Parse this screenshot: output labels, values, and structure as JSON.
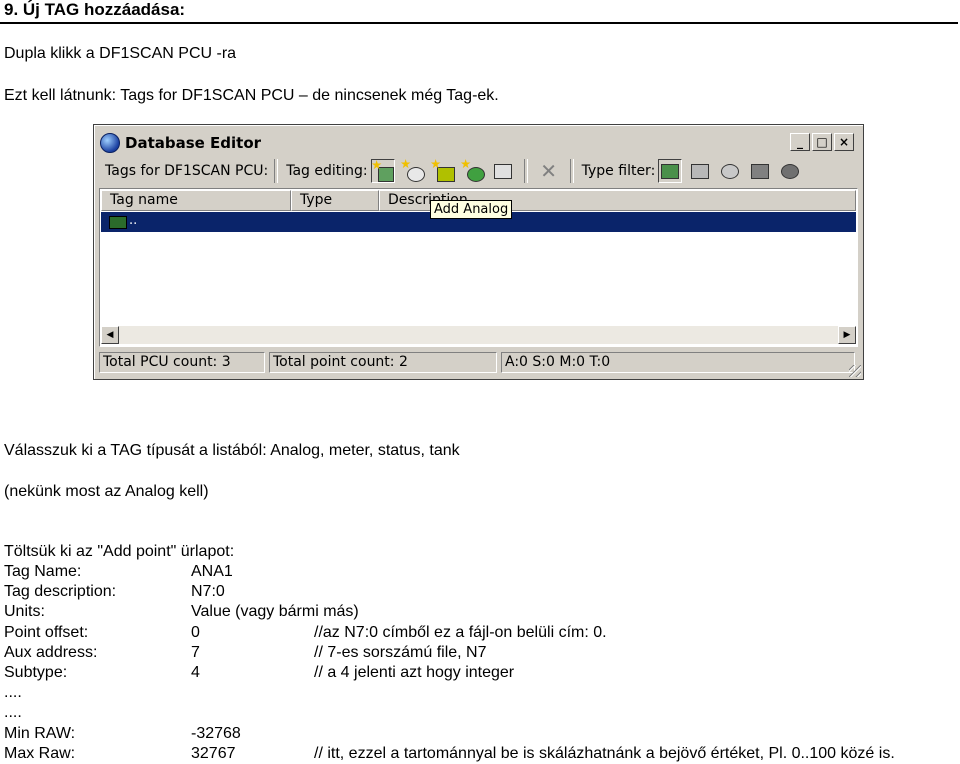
{
  "heading": "9. Új TAG hozzáadása:",
  "intro": [
    "Dupla klikk a DF1SCAN PCU -ra",
    "Ezt kell látnunk: Tags for DF1SCAN PCU – de nincsenek még Tag-ek."
  ],
  "window": {
    "title": "Database Editor",
    "controls": [
      "_",
      "□",
      "×"
    ],
    "toolbar": {
      "tags_label": "Tags for DF1SCAN PCU:",
      "editing_label": "Tag editing:",
      "filter_label": "Type filter:"
    },
    "columns": [
      "Tag name",
      "Type",
      "Description"
    ],
    "selected_row_text": "..",
    "tooltip": "Add Analog",
    "status": [
      "Total PCU count: 3",
      "Total point count: 2",
      "A:0 S:0 M:0 T:0"
    ],
    "icons": [
      "add-analog-icon",
      "add-meter-icon",
      "add-status-icon",
      "add-tank-icon",
      "properties-icon",
      "delete-icon",
      "filter-all-icon",
      "filter-analog-icon",
      "filter-meter-icon",
      "filter-status-icon",
      "filter-tank-icon"
    ]
  },
  "para2": [
    "Válasszuk ki a TAG típusát a listából: Analog, meter, status, tank",
    "(nekünk most az Analog kell)"
  ],
  "form_intro": "Töltsük ki az \"Add point\" ürlapot:",
  "form": [
    {
      "key": "Tag Name:",
      "value": "ANA1",
      "comment": ""
    },
    {
      "key": "Tag description:",
      "value": "N7:0",
      "comment": ""
    },
    {
      "key": "Units:",
      "value": "Value  (vagy bármi más)",
      "comment": ""
    },
    {
      "key": "Point offset:",
      "value": "0",
      "comment": "//az N7:0 címből ez a fájl-on belüli cím: 0."
    },
    {
      "key": "Aux address:",
      "value": "7",
      "comment": "// 7-es sorszámú file, N7"
    },
    {
      "key": "Subtype:",
      "value": "4",
      "comment": "// a 4 jelenti azt hogy integer"
    },
    {
      "key": "....",
      "value": "",
      "comment": ""
    },
    {
      "key": "....",
      "value": "",
      "comment": ""
    },
    {
      "key": "Min RAW:",
      "value": "-32768",
      "comment": ""
    },
    {
      "key": "Max Raw:",
      "value": "32767",
      "comment": "// itt, ezzel a tartománnyal be is skálázhatnánk a bejövő értéket, Pl. 0..100 közé is."
    }
  ]
}
